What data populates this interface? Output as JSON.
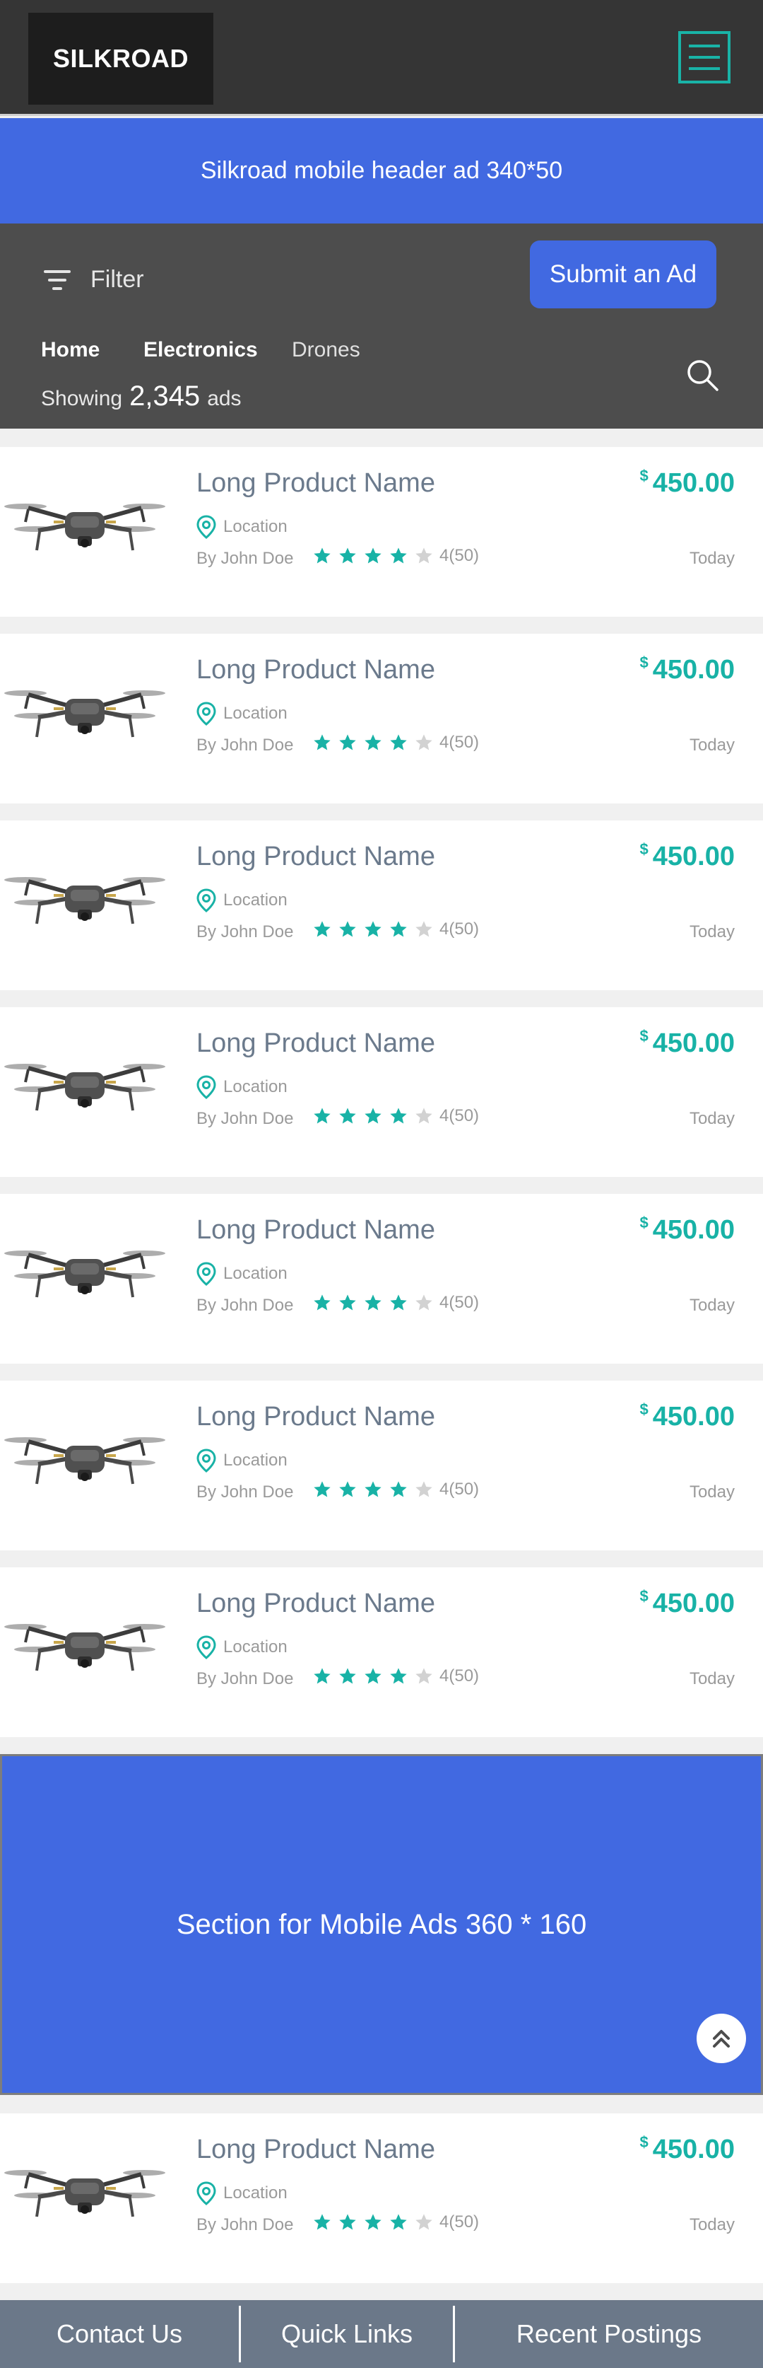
{
  "brand": {
    "name": "SILKROAD"
  },
  "header_ad": {
    "text": "Silkroad mobile header ad 340*50"
  },
  "toolbar": {
    "filter_label": "Filter",
    "submit_label": "Submit an Ad",
    "breadcrumbs": [
      "Home",
      "Electronics",
      "Drones"
    ],
    "showing_prefix": "Showing",
    "showing_count": "2,345",
    "showing_suffix": "ads"
  },
  "listings": [
    {
      "name": "Long Product Name",
      "currency": "$",
      "price": "450.00",
      "location": "Location",
      "by": "By John Doe",
      "rating": 4,
      "rating_text": "4(50)",
      "date": "Today"
    },
    {
      "name": "Long Product Name",
      "currency": "$",
      "price": "450.00",
      "location": "Location",
      "by": "By John Doe",
      "rating": 4,
      "rating_text": "4(50)",
      "date": "Today"
    },
    {
      "name": "Long Product Name",
      "currency": "$",
      "price": "450.00",
      "location": "Location",
      "by": "By John Doe",
      "rating": 4,
      "rating_text": "4(50)",
      "date": "Today"
    },
    {
      "name": "Long Product Name",
      "currency": "$",
      "price": "450.00",
      "location": "Location",
      "by": "By John Doe",
      "rating": 4,
      "rating_text": "4(50)",
      "date": "Today"
    },
    {
      "name": "Long Product Name",
      "currency": "$",
      "price": "450.00",
      "location": "Location",
      "by": "By John Doe",
      "rating": 4,
      "rating_text": "4(50)",
      "date": "Today"
    },
    {
      "name": "Long Product Name",
      "currency": "$",
      "price": "450.00",
      "location": "Location",
      "by": "By John Doe",
      "rating": 4,
      "rating_text": "4(50)",
      "date": "Today"
    },
    {
      "name": "Long Product Name",
      "currency": "$",
      "price": "450.00",
      "location": "Location",
      "by": "By John Doe",
      "rating": 4,
      "rating_text": "4(50)",
      "date": "Today"
    },
    {
      "name": "Long Product Name",
      "currency": "$",
      "price": "450.00",
      "location": "Location",
      "by": "By John Doe",
      "rating": 4,
      "rating_text": "4(50)",
      "date": "Today"
    }
  ],
  "mobile_ad": {
    "text": "Section for Mobile Ads 360 * 160"
  },
  "footer": {
    "links": [
      "Contact Us",
      "Quick Links",
      "Recent Postings"
    ]
  },
  "colors": {
    "accent": "#4169e1",
    "teal": "#18b2a6",
    "dark": "#353535",
    "toolbar": "#4d4d4d",
    "footer": "#6b7889"
  },
  "icons": [
    "menu-icon",
    "filter-icon",
    "search-icon",
    "location-pin-icon",
    "star-icon",
    "chevron-up-double-icon"
  ]
}
